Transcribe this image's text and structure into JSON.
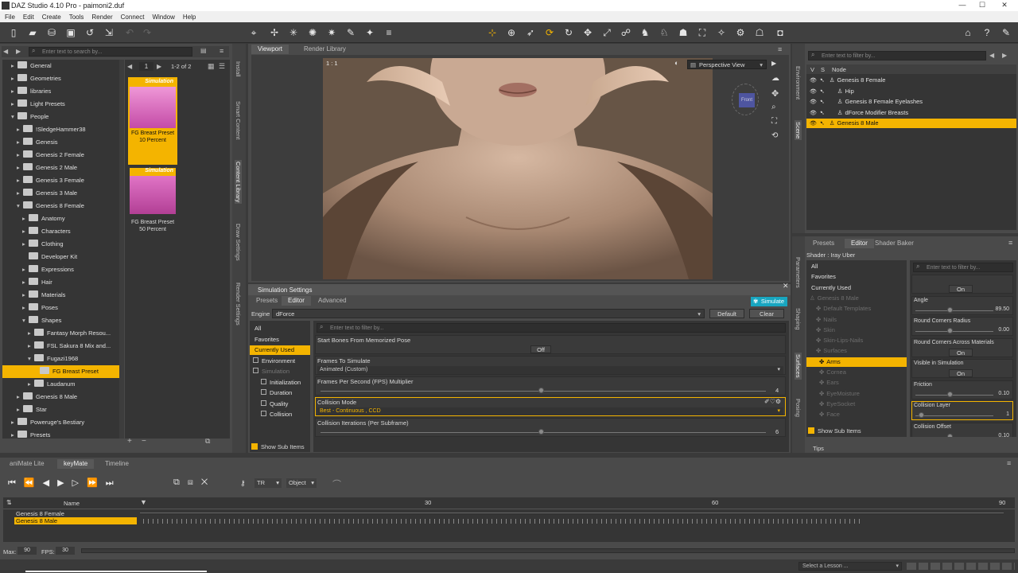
{
  "window": {
    "title": "DAZ Studio 4.10 Pro - paimoni2.duf",
    "controls": [
      "—",
      "☐",
      "✕"
    ]
  },
  "menu": [
    "File",
    "Edit",
    "Create",
    "Tools",
    "Render",
    "Connect",
    "Window",
    "Help"
  ],
  "library": {
    "search_placeholder": "Enter text to search by...",
    "items": [
      {
        "label": "General",
        "indent": 1
      },
      {
        "label": "Geometries",
        "indent": 1
      },
      {
        "label": "libraries",
        "indent": 1
      },
      {
        "label": "Light Presets",
        "indent": 1
      },
      {
        "label": "People",
        "indent": 1
      },
      {
        "label": "!SledgeHammer38",
        "indent": 2
      },
      {
        "label": "Genesis",
        "indent": 2
      },
      {
        "label": "Genesis 2 Female",
        "indent": 2
      },
      {
        "label": "Genesis 2 Male",
        "indent": 2
      },
      {
        "label": "Genesis 3 Female",
        "indent": 2
      },
      {
        "label": "Genesis 3 Male",
        "indent": 2
      },
      {
        "label": "Genesis 8 Female",
        "indent": 2
      },
      {
        "label": "Anatomy",
        "indent": 3
      },
      {
        "label": "Characters",
        "indent": 3
      },
      {
        "label": "Clothing",
        "indent": 3
      },
      {
        "label": "Developer Kit",
        "indent": 3
      },
      {
        "label": "Expressions",
        "indent": 3
      },
      {
        "label": "Hair",
        "indent": 3
      },
      {
        "label": "Materials",
        "indent": 3
      },
      {
        "label": "Poses",
        "indent": 3
      },
      {
        "label": "Shapes",
        "indent": 3
      },
      {
        "label": "Fantasy Morph Resou...",
        "indent": 4
      },
      {
        "label": "FSL Sakura 8 Mix and...",
        "indent": 4
      },
      {
        "label": "Fugazi1968",
        "indent": 4
      },
      {
        "label": "FG Breast Preset",
        "indent": 5
      },
      {
        "label": "Laudanum",
        "indent": 4
      },
      {
        "label": "Genesis 8 Male",
        "indent": 2
      },
      {
        "label": "Star",
        "indent": 2
      },
      {
        "label": "Poweruge's Bestiary",
        "indent": 1
      },
      {
        "label": "Presets",
        "indent": 1
      }
    ],
    "page": "1",
    "page_count": "1-2 of 2",
    "thumbs": [
      {
        "badge": "Simulation",
        "caption1": "FG Breast Preset",
        "caption2": "10 Percent"
      },
      {
        "badge": "Simulation",
        "caption1": "FG Breast Preset",
        "caption2": "50 Percent"
      }
    ]
  },
  "side_tabs_left": [
    "Install",
    "Smart Content",
    "Content Library",
    "Draw Settings",
    "Render Settings"
  ],
  "viewport": {
    "tabs": [
      "Viewport",
      "Render Library"
    ],
    "view": "Perspective View",
    "corner": "1 : 1",
    "cube_label": "Front"
  },
  "simulation": {
    "title": "Simulation Settings",
    "tabs": [
      "Presets",
      "Editor",
      "Advanced"
    ],
    "simulate": "Simulate",
    "engine_label": "Engine",
    "engine_value": "dForce",
    "default_btn": "Default",
    "clear_btn": "Clear",
    "filter_placeholder": "Enter text to filter by...",
    "groups": [
      "All",
      "Favorites",
      "Currently Used",
      "Environment",
      "Simulation",
      "Initialization",
      "Duration",
      "Quality",
      "Collision"
    ],
    "show_sub": "Show Sub Items",
    "props": [
      {
        "name": "Start Bones From Memorized Pose",
        "value": "Off"
      },
      {
        "name": "Frames To Simulate",
        "value": "Animated (Custom)"
      },
      {
        "name": "Frames Per Second (FPS) Multiplier",
        "value": "4"
      },
      {
        "name": "Collision Mode",
        "value": "Best - Continuous , CCD"
      },
      {
        "name": "Collision Iterations (Per Subframe)",
        "value": "6"
      }
    ]
  },
  "scene": {
    "filter_placeholder": "Enter text to filter by...",
    "header": [
      "V",
      "S",
      "Node"
    ],
    "nodes": [
      {
        "label": "Genesis 8 Female",
        "indent": 0
      },
      {
        "label": "Hip",
        "indent": 1
      },
      {
        "label": "Genesis 8 Female Eyelashes",
        "indent": 1
      },
      {
        "label": "dForce Modifier Breasts",
        "indent": 1
      },
      {
        "label": "Genesis 8 Male",
        "indent": 0
      }
    ]
  },
  "side_tabs_right_top": [
    "Environment",
    "Scene"
  ],
  "side_tabs_right_bottom": [
    "Parameters",
    "Shaping",
    "Surfaces",
    "Posing"
  ],
  "surfaces": {
    "tabs": [
      "Presets",
      "Editor",
      "Shader Baker"
    ],
    "shader": "Shader : Iray Uber",
    "filter_placeholder": "Enter text to filter by...",
    "groups": [
      "All",
      "Favorites",
      "Currently Used",
      "Genesis 8 Male",
      "Default Templates",
      "Nails",
      "Skin",
      "Skin-Lips-Nails",
      "Surfaces",
      "Arms",
      "Cornea",
      "Ears",
      "EyeMoisture",
      "EyeSocket",
      "Face"
    ],
    "show_sub": "Show Sub Items",
    "tips": "Tips",
    "props": [
      {
        "name": "",
        "value": "On"
      },
      {
        "name": "Angle",
        "value": "89.50"
      },
      {
        "name": "Round Corners Radius",
        "value": "0.00"
      },
      {
        "name": "Round Corners Across Materials",
        "value": "On"
      },
      {
        "name": "Visible in Simulation",
        "value": "On"
      },
      {
        "name": "Friction",
        "value": "0.10"
      },
      {
        "name": "Collision Layer",
        "value": "1"
      },
      {
        "name": "Collision Offset",
        "value": "0.10"
      }
    ]
  },
  "timeline": {
    "tabs": [
      "aniMate Lite",
      "keyMate",
      "Timeline"
    ],
    "tr": "TR",
    "object": "Object",
    "name_col": "Name",
    "ticks": [
      "30",
      "60",
      "90"
    ],
    "rows": [
      "Genesis 8 Female",
      "Genesis 8 Male"
    ],
    "max_label": "Max:",
    "max_value": "90",
    "fps_label": "FPS:",
    "fps_value": "30"
  },
  "lesson": "Select a Lesson ..."
}
